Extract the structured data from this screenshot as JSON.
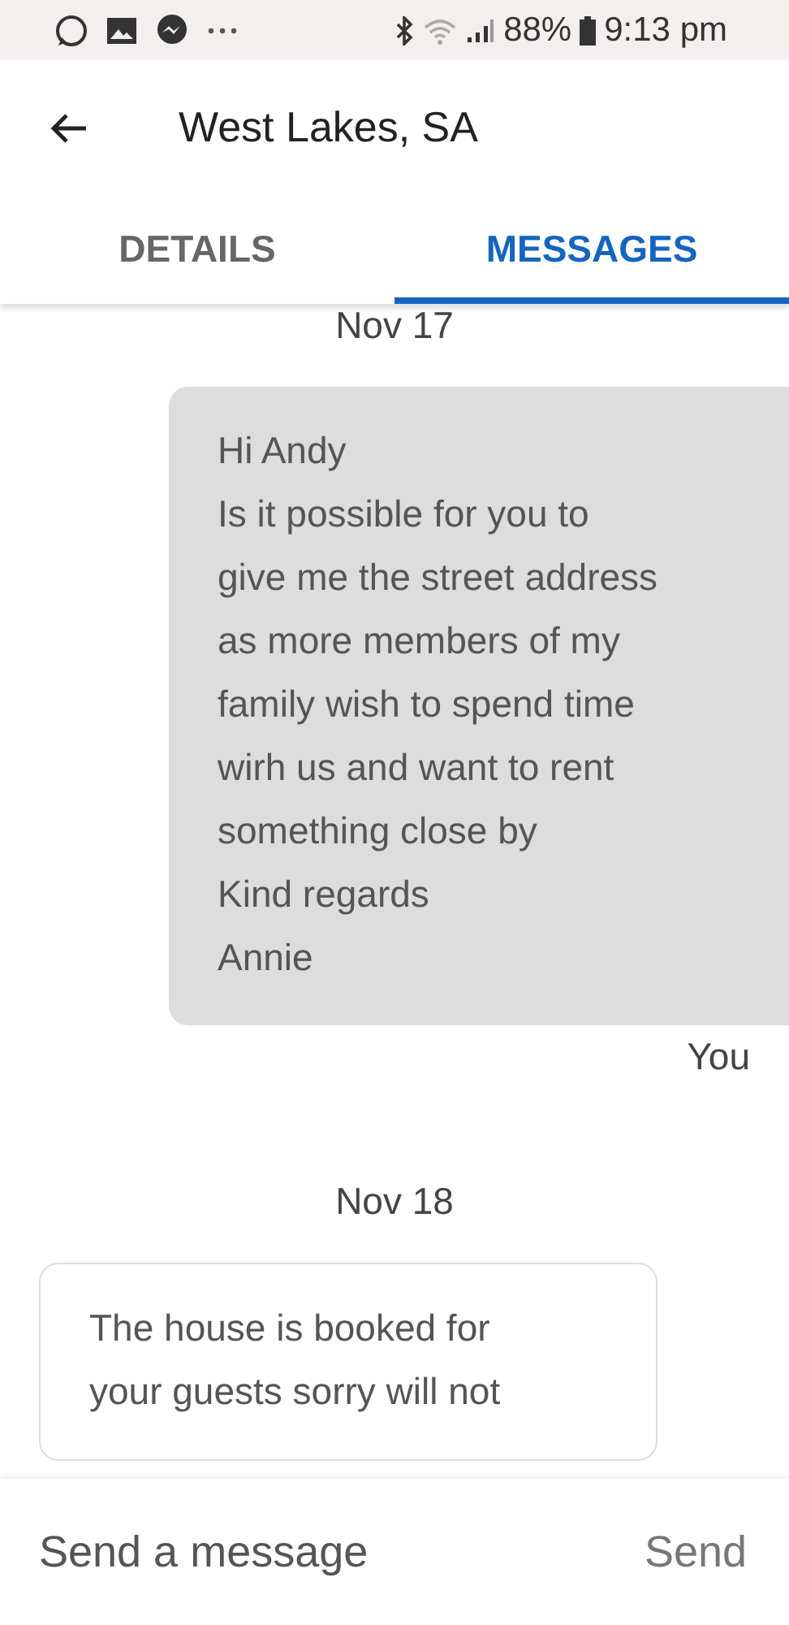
{
  "status_bar": {
    "battery": "88%",
    "time": "9:13 pm"
  },
  "header": {
    "title": "West Lakes, SA"
  },
  "tabs": [
    {
      "label": "DETAILS",
      "selected": false
    },
    {
      "label": "MESSAGES",
      "selected": true
    }
  ],
  "messages": [
    {
      "kind": "date",
      "text": "Nov 17"
    },
    {
      "kind": "sent",
      "text": "Hi Andy\nIs it possible for you to\ngive me the street address\nas more members of my\nfamily wish to spend time\nwirh us and want to rent\nsomething close by\nKind regards\nAnnie",
      "sender": "You"
    },
    {
      "kind": "date",
      "text": "Nov 18"
    },
    {
      "kind": "received",
      "text": "The house is booked for\nyour guests sorry will not"
    }
  ],
  "composer": {
    "placeholder": "Send a message",
    "send": "Send"
  }
}
